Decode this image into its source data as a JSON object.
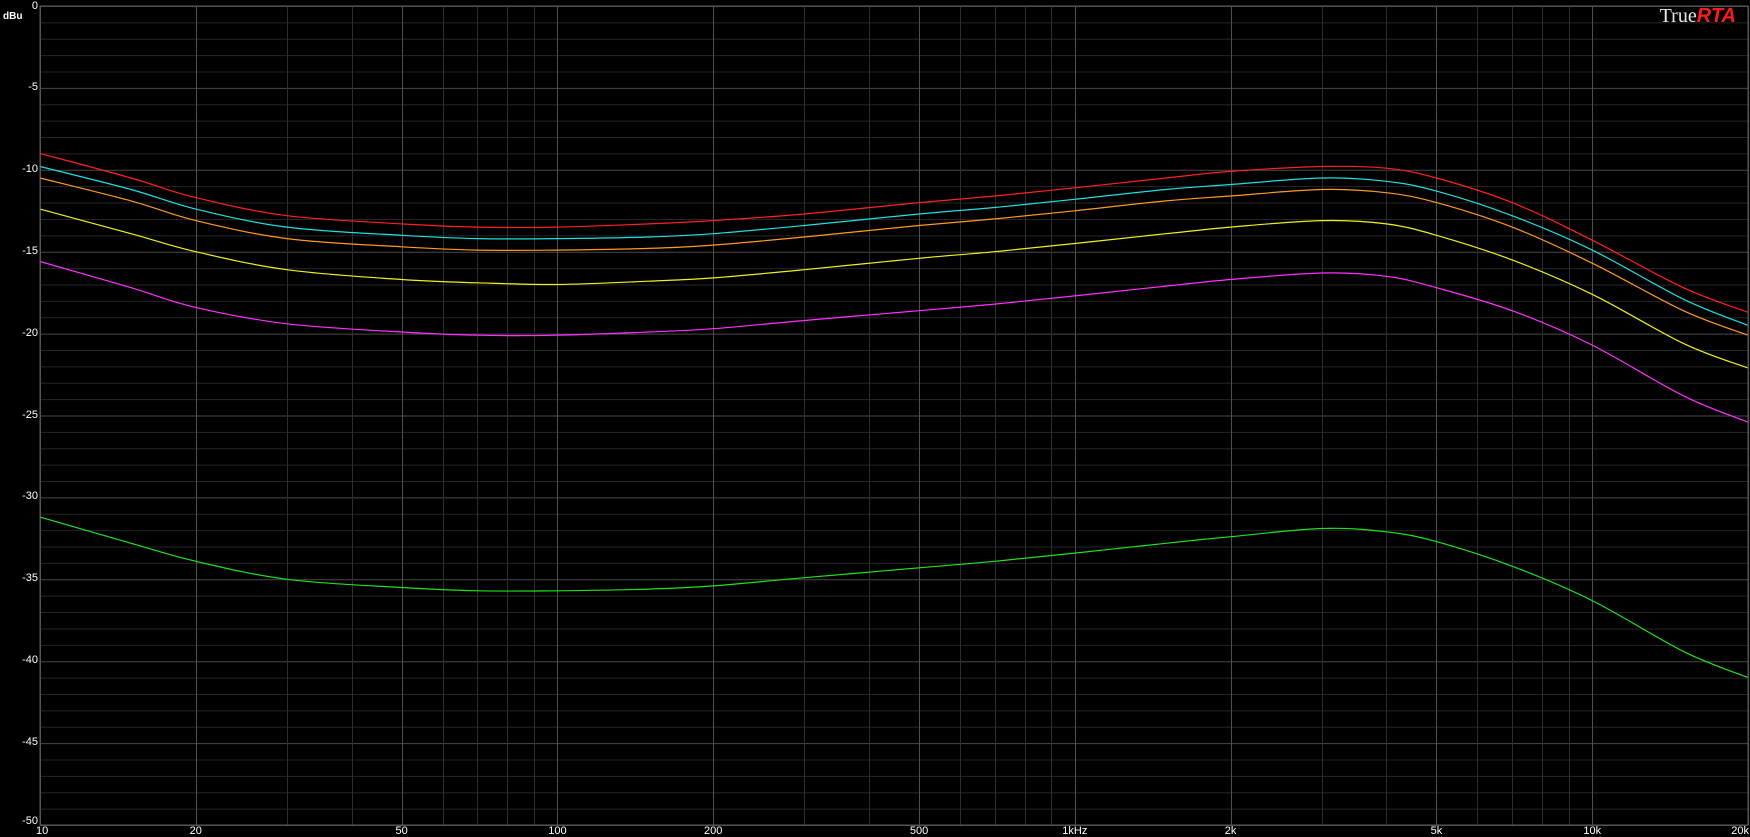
{
  "brand": {
    "prefix": "True",
    "suffix": "RTA"
  },
  "chart_data": {
    "type": "line",
    "ylabel": "dBu",
    "x_scale": "log",
    "xlim": [
      10,
      20000
    ],
    "ylim": [
      -50,
      0
    ],
    "grid": true,
    "y_ticks": [
      "0",
      "-5",
      "-10",
      "-15",
      "-20",
      "-25",
      "-30",
      "-35",
      "-40",
      "-45",
      "-50"
    ],
    "x_ticks": [
      {
        "value": 10,
        "label": "10"
      },
      {
        "value": 20,
        "label": "20"
      },
      {
        "value": 50,
        "label": "50"
      },
      {
        "value": 100,
        "label": "100"
      },
      {
        "value": 200,
        "label": "200"
      },
      {
        "value": 500,
        "label": "500"
      },
      {
        "value": 1000,
        "label": "1kHz"
      },
      {
        "value": 2000,
        "label": "2k"
      },
      {
        "value": 5000,
        "label": "5k"
      },
      {
        "value": 10000,
        "label": "10k"
      },
      {
        "value": 20000,
        "label": "20k"
      }
    ],
    "x": [
      10,
      15,
      20,
      30,
      50,
      70,
      100,
      150,
      200,
      300,
      500,
      700,
      1000,
      1500,
      2000,
      3000,
      4000,
      5000,
      7000,
      10000,
      15000,
      20000
    ],
    "series": [
      {
        "color": "#ff2020",
        "values": [
          -9.0,
          -10.5,
          -11.7,
          -12.8,
          -13.3,
          -13.5,
          -13.5,
          -13.3,
          -13.1,
          -12.7,
          -12.0,
          -11.6,
          -11.1,
          -10.5,
          -10.1,
          -9.8,
          -9.9,
          -10.5,
          -12.0,
          -14.3,
          -17.2,
          -18.7
        ]
      },
      {
        "color": "#20e0e0",
        "values": [
          -9.8,
          -11.2,
          -12.4,
          -13.5,
          -14.0,
          -14.2,
          -14.2,
          -14.1,
          -13.9,
          -13.4,
          -12.7,
          -12.3,
          -11.8,
          -11.2,
          -10.9,
          -10.5,
          -10.7,
          -11.3,
          -12.8,
          -14.9,
          -17.9,
          -19.5
        ]
      },
      {
        "color": "#ff9a20",
        "values": [
          -10.5,
          -11.9,
          -13.1,
          -14.2,
          -14.7,
          -14.9,
          -14.9,
          -14.8,
          -14.6,
          -14.1,
          -13.4,
          -13.0,
          -12.5,
          -11.9,
          -11.6,
          -11.2,
          -11.4,
          -12.0,
          -13.5,
          -15.7,
          -18.6,
          -20.1
        ]
      },
      {
        "color": "#f0f020",
        "values": [
          -12.4,
          -13.9,
          -15.0,
          -16.1,
          -16.7,
          -16.9,
          -17.0,
          -16.8,
          -16.6,
          -16.1,
          -15.4,
          -15.0,
          -14.5,
          -13.9,
          -13.5,
          -13.1,
          -13.3,
          -14.0,
          -15.5,
          -17.6,
          -20.6,
          -22.1
        ]
      },
      {
        "color": "#ff30ff",
        "values": [
          -15.6,
          -17.2,
          -18.4,
          -19.4,
          -19.9,
          -20.1,
          -20.1,
          -19.9,
          -19.7,
          -19.2,
          -18.6,
          -18.2,
          -17.7,
          -17.1,
          -16.7,
          -16.3,
          -16.5,
          -17.2,
          -18.6,
          -20.7,
          -23.8,
          -25.4
        ]
      },
      {
        "color": "#20e020",
        "values": [
          -31.2,
          -32.8,
          -33.9,
          -35.0,
          -35.5,
          -35.7,
          -35.7,
          -35.6,
          -35.4,
          -34.9,
          -34.3,
          -33.9,
          -33.4,
          -32.8,
          -32.4,
          -31.9,
          -32.1,
          -32.7,
          -34.2,
          -36.3,
          -39.4,
          -41.0
        ]
      }
    ]
  }
}
